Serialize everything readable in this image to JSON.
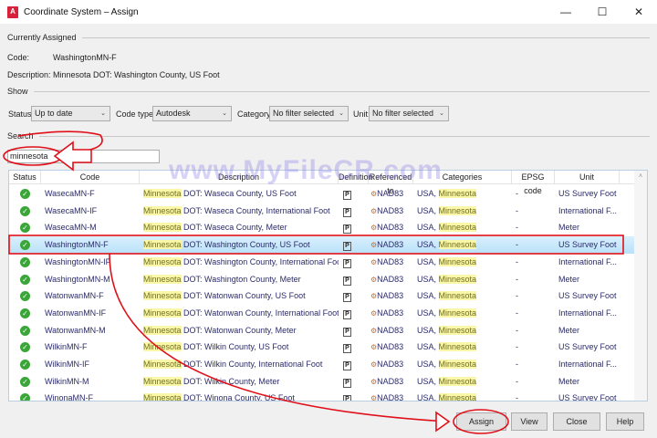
{
  "window": {
    "title": "Coordinate System – Assign",
    "app_icon": "A",
    "minimize": "—",
    "maximize": "☐",
    "close": "✕"
  },
  "current": {
    "section": "Currently Assigned",
    "code_label": "Code:",
    "code": "WashingtonMN-F",
    "desc_label": "Description:",
    "description": "Minnesota DOT: Washington County, US Foot"
  },
  "show": {
    "section": "Show",
    "status_label": "Status:",
    "status": "Up to date",
    "codetype_label": "Code type:",
    "codetype": "Autodesk",
    "category_label": "Category:",
    "category": "No filter selected",
    "unit_label": "Unit:",
    "unit": "No filter selected"
  },
  "search": {
    "section": "Search",
    "value": "minnesota"
  },
  "table": {
    "headers": [
      "Status",
      "Code",
      "Description",
      "Definition",
      "Referenced to",
      "Categories",
      "EPSG code",
      "Unit"
    ],
    "rows": [
      {
        "code": "WasecaMN-F",
        "hl": "Minnesota",
        "desc": " DOT: Waseca County, US Foot",
        "ref": "NAD83",
        "cat": "USA, ",
        "cathl": "Minnesota",
        "epsg": "-",
        "unit": "US Survey Foot"
      },
      {
        "code": "WasecaMN-IF",
        "hl": "Minnesota",
        "desc": " DOT: Waseca County, International Foot",
        "ref": "NAD83",
        "cat": "USA, ",
        "cathl": "Minnesota",
        "epsg": "-",
        "unit": "International F..."
      },
      {
        "code": "WasecaMN-M",
        "hl": "Minnesota",
        "desc": " DOT: Waseca County, Meter",
        "ref": "NAD83",
        "cat": "USA, ",
        "cathl": "Minnesota",
        "epsg": "-",
        "unit": "Meter"
      },
      {
        "code": "WashingtonMN-F",
        "hl": "Minnesota",
        "desc": " DOT: Washington County, US Foot",
        "ref": "NAD83",
        "cat": "USA, ",
        "cathl": "Minnesota",
        "epsg": "-",
        "unit": "US Survey Foot",
        "selected": true
      },
      {
        "code": "WashingtonMN-IF",
        "hl": "Minnesota",
        "desc": " DOT: Washington County, International Foot",
        "ref": "NAD83",
        "cat": "USA, ",
        "cathl": "Minnesota",
        "epsg": "-",
        "unit": "International F..."
      },
      {
        "code": "WashingtonMN-M",
        "hl": "Minnesota",
        "desc": " DOT: Washington County, Meter",
        "ref": "NAD83",
        "cat": "USA, ",
        "cathl": "Minnesota",
        "epsg": "-",
        "unit": "Meter"
      },
      {
        "code": "WatonwanMN-F",
        "hl": "Minnesota",
        "desc": " DOT: Watonwan County, US Foot",
        "ref": "NAD83",
        "cat": "USA, ",
        "cathl": "Minnesota",
        "epsg": "-",
        "unit": "US Survey Foot"
      },
      {
        "code": "WatonwanMN-IF",
        "hl": "Minnesota",
        "desc": " DOT: Watonwan County, International Foot",
        "ref": "NAD83",
        "cat": "USA, ",
        "cathl": "Minnesota",
        "epsg": "-",
        "unit": "International F..."
      },
      {
        "code": "WatonwanMN-M",
        "hl": "Minnesota",
        "desc": " DOT: Watonwan County, Meter",
        "ref": "NAD83",
        "cat": "USA, ",
        "cathl": "Minnesota",
        "epsg": "-",
        "unit": "Meter"
      },
      {
        "code": "WilkinMN-F",
        "hl": "Minnesota",
        "desc": " DOT: Wilkin County, US Foot",
        "ref": "NAD83",
        "cat": "USA, ",
        "cathl": "Minnesota",
        "epsg": "-",
        "unit": "US Survey Foot"
      },
      {
        "code": "WilkinMN-IF",
        "hl": "Minnesota",
        "desc": " DOT: Wilkin County, International Foot",
        "ref": "NAD83",
        "cat": "USA, ",
        "cathl": "Minnesota",
        "epsg": "-",
        "unit": "International F..."
      },
      {
        "code": "WilkinMN-M",
        "hl": "Minnesota",
        "desc": " DOT: Wilkin County, Meter",
        "ref": "NAD83",
        "cat": "USA, ",
        "cathl": "Minnesota",
        "epsg": "-",
        "unit": "Meter"
      },
      {
        "code": "WinonaMN-F",
        "hl": "Minnesota",
        "desc": " DOT: Winona County, US Foot",
        "ref": "NAD83",
        "cat": "USA, ",
        "cathl": "Minnesota",
        "epsg": "-",
        "unit": "US Survey Foot"
      }
    ]
  },
  "buttons": {
    "assign": "Assign",
    "view": "View",
    "close": "Close",
    "help": "Help"
  },
  "watermark": "www.MyFileCR.com",
  "colors": {
    "annotation": "#e0101a",
    "selected_row": "#c6e8fb",
    "highlight": "#fbf7a8",
    "status_ok": "#3aa637"
  }
}
